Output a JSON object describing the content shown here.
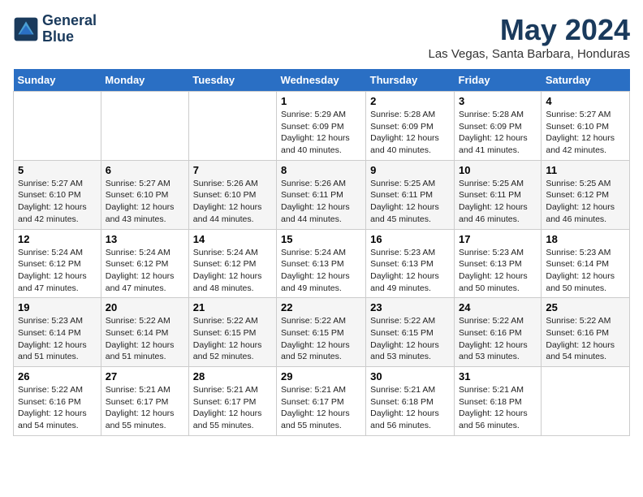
{
  "header": {
    "logo_line1": "General",
    "logo_line2": "Blue",
    "month_title": "May 2024",
    "location": "Las Vegas, Santa Barbara, Honduras"
  },
  "weekdays": [
    "Sunday",
    "Monday",
    "Tuesday",
    "Wednesday",
    "Thursday",
    "Friday",
    "Saturday"
  ],
  "weeks": [
    [
      {
        "day": "",
        "sunrise": "",
        "sunset": "",
        "daylight": ""
      },
      {
        "day": "",
        "sunrise": "",
        "sunset": "",
        "daylight": ""
      },
      {
        "day": "",
        "sunrise": "",
        "sunset": "",
        "daylight": ""
      },
      {
        "day": "1",
        "sunrise": "Sunrise: 5:29 AM",
        "sunset": "Sunset: 6:09 PM",
        "daylight": "Daylight: 12 hours and 40 minutes."
      },
      {
        "day": "2",
        "sunrise": "Sunrise: 5:28 AM",
        "sunset": "Sunset: 6:09 PM",
        "daylight": "Daylight: 12 hours and 40 minutes."
      },
      {
        "day": "3",
        "sunrise": "Sunrise: 5:28 AM",
        "sunset": "Sunset: 6:09 PM",
        "daylight": "Daylight: 12 hours and 41 minutes."
      },
      {
        "day": "4",
        "sunrise": "Sunrise: 5:27 AM",
        "sunset": "Sunset: 6:10 PM",
        "daylight": "Daylight: 12 hours and 42 minutes."
      }
    ],
    [
      {
        "day": "5",
        "sunrise": "Sunrise: 5:27 AM",
        "sunset": "Sunset: 6:10 PM",
        "daylight": "Daylight: 12 hours and 42 minutes."
      },
      {
        "day": "6",
        "sunrise": "Sunrise: 5:27 AM",
        "sunset": "Sunset: 6:10 PM",
        "daylight": "Daylight: 12 hours and 43 minutes."
      },
      {
        "day": "7",
        "sunrise": "Sunrise: 5:26 AM",
        "sunset": "Sunset: 6:10 PM",
        "daylight": "Daylight: 12 hours and 44 minutes."
      },
      {
        "day": "8",
        "sunrise": "Sunrise: 5:26 AM",
        "sunset": "Sunset: 6:11 PM",
        "daylight": "Daylight: 12 hours and 44 minutes."
      },
      {
        "day": "9",
        "sunrise": "Sunrise: 5:25 AM",
        "sunset": "Sunset: 6:11 PM",
        "daylight": "Daylight: 12 hours and 45 minutes."
      },
      {
        "day": "10",
        "sunrise": "Sunrise: 5:25 AM",
        "sunset": "Sunset: 6:11 PM",
        "daylight": "Daylight: 12 hours and 46 minutes."
      },
      {
        "day": "11",
        "sunrise": "Sunrise: 5:25 AM",
        "sunset": "Sunset: 6:12 PM",
        "daylight": "Daylight: 12 hours and 46 minutes."
      }
    ],
    [
      {
        "day": "12",
        "sunrise": "Sunrise: 5:24 AM",
        "sunset": "Sunset: 6:12 PM",
        "daylight": "Daylight: 12 hours and 47 minutes."
      },
      {
        "day": "13",
        "sunrise": "Sunrise: 5:24 AM",
        "sunset": "Sunset: 6:12 PM",
        "daylight": "Daylight: 12 hours and 47 minutes."
      },
      {
        "day": "14",
        "sunrise": "Sunrise: 5:24 AM",
        "sunset": "Sunset: 6:12 PM",
        "daylight": "Daylight: 12 hours and 48 minutes."
      },
      {
        "day": "15",
        "sunrise": "Sunrise: 5:24 AM",
        "sunset": "Sunset: 6:13 PM",
        "daylight": "Daylight: 12 hours and 49 minutes."
      },
      {
        "day": "16",
        "sunrise": "Sunrise: 5:23 AM",
        "sunset": "Sunset: 6:13 PM",
        "daylight": "Daylight: 12 hours and 49 minutes."
      },
      {
        "day": "17",
        "sunrise": "Sunrise: 5:23 AM",
        "sunset": "Sunset: 6:13 PM",
        "daylight": "Daylight: 12 hours and 50 minutes."
      },
      {
        "day": "18",
        "sunrise": "Sunrise: 5:23 AM",
        "sunset": "Sunset: 6:14 PM",
        "daylight": "Daylight: 12 hours and 50 minutes."
      }
    ],
    [
      {
        "day": "19",
        "sunrise": "Sunrise: 5:23 AM",
        "sunset": "Sunset: 6:14 PM",
        "daylight": "Daylight: 12 hours and 51 minutes."
      },
      {
        "day": "20",
        "sunrise": "Sunrise: 5:22 AM",
        "sunset": "Sunset: 6:14 PM",
        "daylight": "Daylight: 12 hours and 51 minutes."
      },
      {
        "day": "21",
        "sunrise": "Sunrise: 5:22 AM",
        "sunset": "Sunset: 6:15 PM",
        "daylight": "Daylight: 12 hours and 52 minutes."
      },
      {
        "day": "22",
        "sunrise": "Sunrise: 5:22 AM",
        "sunset": "Sunset: 6:15 PM",
        "daylight": "Daylight: 12 hours and 52 minutes."
      },
      {
        "day": "23",
        "sunrise": "Sunrise: 5:22 AM",
        "sunset": "Sunset: 6:15 PM",
        "daylight": "Daylight: 12 hours and 53 minutes."
      },
      {
        "day": "24",
        "sunrise": "Sunrise: 5:22 AM",
        "sunset": "Sunset: 6:16 PM",
        "daylight": "Daylight: 12 hours and 53 minutes."
      },
      {
        "day": "25",
        "sunrise": "Sunrise: 5:22 AM",
        "sunset": "Sunset: 6:16 PM",
        "daylight": "Daylight: 12 hours and 54 minutes."
      }
    ],
    [
      {
        "day": "26",
        "sunrise": "Sunrise: 5:22 AM",
        "sunset": "Sunset: 6:16 PM",
        "daylight": "Daylight: 12 hours and 54 minutes."
      },
      {
        "day": "27",
        "sunrise": "Sunrise: 5:21 AM",
        "sunset": "Sunset: 6:17 PM",
        "daylight": "Daylight: 12 hours and 55 minutes."
      },
      {
        "day": "28",
        "sunrise": "Sunrise: 5:21 AM",
        "sunset": "Sunset: 6:17 PM",
        "daylight": "Daylight: 12 hours and 55 minutes."
      },
      {
        "day": "29",
        "sunrise": "Sunrise: 5:21 AM",
        "sunset": "Sunset: 6:17 PM",
        "daylight": "Daylight: 12 hours and 55 minutes."
      },
      {
        "day": "30",
        "sunrise": "Sunrise: 5:21 AM",
        "sunset": "Sunset: 6:18 PM",
        "daylight": "Daylight: 12 hours and 56 minutes."
      },
      {
        "day": "31",
        "sunrise": "Sunrise: 5:21 AM",
        "sunset": "Sunset: 6:18 PM",
        "daylight": "Daylight: 12 hours and 56 minutes."
      },
      {
        "day": "",
        "sunrise": "",
        "sunset": "",
        "daylight": ""
      }
    ]
  ]
}
